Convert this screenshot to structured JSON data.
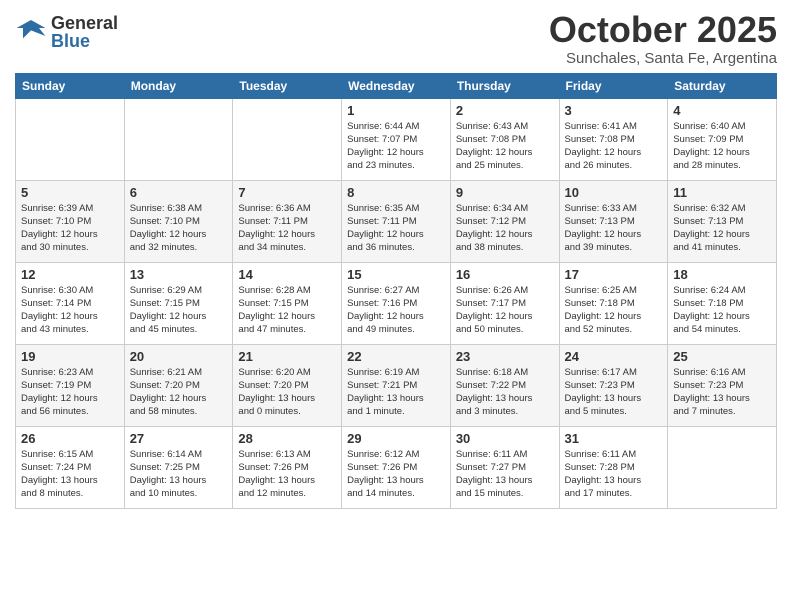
{
  "header": {
    "logo_general": "General",
    "logo_blue": "Blue",
    "month_title": "October 2025",
    "location": "Sunchales, Santa Fe, Argentina"
  },
  "days_of_week": [
    "Sunday",
    "Monday",
    "Tuesday",
    "Wednesday",
    "Thursday",
    "Friday",
    "Saturday"
  ],
  "weeks": [
    [
      {
        "day": "",
        "info": ""
      },
      {
        "day": "",
        "info": ""
      },
      {
        "day": "",
        "info": ""
      },
      {
        "day": "1",
        "info": "Sunrise: 6:44 AM\nSunset: 7:07 PM\nDaylight: 12 hours\nand 23 minutes."
      },
      {
        "day": "2",
        "info": "Sunrise: 6:43 AM\nSunset: 7:08 PM\nDaylight: 12 hours\nand 25 minutes."
      },
      {
        "day": "3",
        "info": "Sunrise: 6:41 AM\nSunset: 7:08 PM\nDaylight: 12 hours\nand 26 minutes."
      },
      {
        "day": "4",
        "info": "Sunrise: 6:40 AM\nSunset: 7:09 PM\nDaylight: 12 hours\nand 28 minutes."
      }
    ],
    [
      {
        "day": "5",
        "info": "Sunrise: 6:39 AM\nSunset: 7:10 PM\nDaylight: 12 hours\nand 30 minutes."
      },
      {
        "day": "6",
        "info": "Sunrise: 6:38 AM\nSunset: 7:10 PM\nDaylight: 12 hours\nand 32 minutes."
      },
      {
        "day": "7",
        "info": "Sunrise: 6:36 AM\nSunset: 7:11 PM\nDaylight: 12 hours\nand 34 minutes."
      },
      {
        "day": "8",
        "info": "Sunrise: 6:35 AM\nSunset: 7:11 PM\nDaylight: 12 hours\nand 36 minutes."
      },
      {
        "day": "9",
        "info": "Sunrise: 6:34 AM\nSunset: 7:12 PM\nDaylight: 12 hours\nand 38 minutes."
      },
      {
        "day": "10",
        "info": "Sunrise: 6:33 AM\nSunset: 7:13 PM\nDaylight: 12 hours\nand 39 minutes."
      },
      {
        "day": "11",
        "info": "Sunrise: 6:32 AM\nSunset: 7:13 PM\nDaylight: 12 hours\nand 41 minutes."
      }
    ],
    [
      {
        "day": "12",
        "info": "Sunrise: 6:30 AM\nSunset: 7:14 PM\nDaylight: 12 hours\nand 43 minutes."
      },
      {
        "day": "13",
        "info": "Sunrise: 6:29 AM\nSunset: 7:15 PM\nDaylight: 12 hours\nand 45 minutes."
      },
      {
        "day": "14",
        "info": "Sunrise: 6:28 AM\nSunset: 7:15 PM\nDaylight: 12 hours\nand 47 minutes."
      },
      {
        "day": "15",
        "info": "Sunrise: 6:27 AM\nSunset: 7:16 PM\nDaylight: 12 hours\nand 49 minutes."
      },
      {
        "day": "16",
        "info": "Sunrise: 6:26 AM\nSunset: 7:17 PM\nDaylight: 12 hours\nand 50 minutes."
      },
      {
        "day": "17",
        "info": "Sunrise: 6:25 AM\nSunset: 7:18 PM\nDaylight: 12 hours\nand 52 minutes."
      },
      {
        "day": "18",
        "info": "Sunrise: 6:24 AM\nSunset: 7:18 PM\nDaylight: 12 hours\nand 54 minutes."
      }
    ],
    [
      {
        "day": "19",
        "info": "Sunrise: 6:23 AM\nSunset: 7:19 PM\nDaylight: 12 hours\nand 56 minutes."
      },
      {
        "day": "20",
        "info": "Sunrise: 6:21 AM\nSunset: 7:20 PM\nDaylight: 12 hours\nand 58 minutes."
      },
      {
        "day": "21",
        "info": "Sunrise: 6:20 AM\nSunset: 7:20 PM\nDaylight: 13 hours\nand 0 minutes."
      },
      {
        "day": "22",
        "info": "Sunrise: 6:19 AM\nSunset: 7:21 PM\nDaylight: 13 hours\nand 1 minute."
      },
      {
        "day": "23",
        "info": "Sunrise: 6:18 AM\nSunset: 7:22 PM\nDaylight: 13 hours\nand 3 minutes."
      },
      {
        "day": "24",
        "info": "Sunrise: 6:17 AM\nSunset: 7:23 PM\nDaylight: 13 hours\nand 5 minutes."
      },
      {
        "day": "25",
        "info": "Sunrise: 6:16 AM\nSunset: 7:23 PM\nDaylight: 13 hours\nand 7 minutes."
      }
    ],
    [
      {
        "day": "26",
        "info": "Sunrise: 6:15 AM\nSunset: 7:24 PM\nDaylight: 13 hours\nand 8 minutes."
      },
      {
        "day": "27",
        "info": "Sunrise: 6:14 AM\nSunset: 7:25 PM\nDaylight: 13 hours\nand 10 minutes."
      },
      {
        "day": "28",
        "info": "Sunrise: 6:13 AM\nSunset: 7:26 PM\nDaylight: 13 hours\nand 12 minutes."
      },
      {
        "day": "29",
        "info": "Sunrise: 6:12 AM\nSunset: 7:26 PM\nDaylight: 13 hours\nand 14 minutes."
      },
      {
        "day": "30",
        "info": "Sunrise: 6:11 AM\nSunset: 7:27 PM\nDaylight: 13 hours\nand 15 minutes."
      },
      {
        "day": "31",
        "info": "Sunrise: 6:11 AM\nSunset: 7:28 PM\nDaylight: 13 hours\nand 17 minutes."
      },
      {
        "day": "",
        "info": ""
      }
    ]
  ]
}
